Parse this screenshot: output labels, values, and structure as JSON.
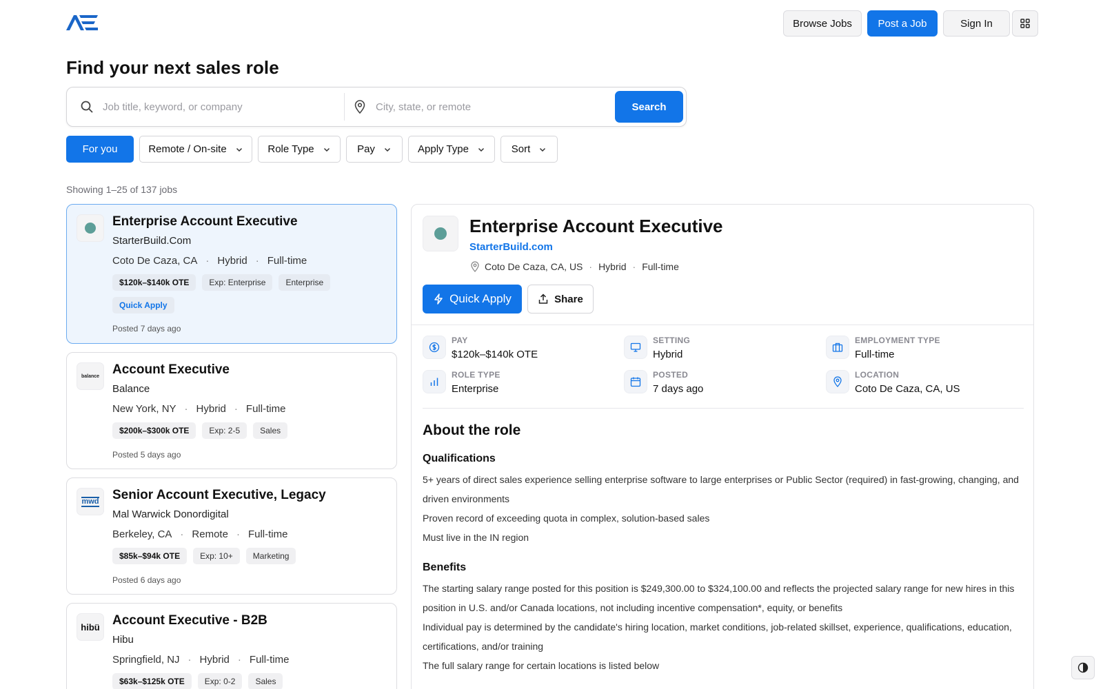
{
  "header": {
    "logo_alt": "AE",
    "browse_label": "Browse Jobs",
    "post_label": "Post a Job",
    "signin_label": "Sign In",
    "grid_icon": "grid-icon"
  },
  "page_title": "Find your next sales role",
  "search": {
    "keyword_placeholder": "Job title, keyword, or company",
    "keyword_value": "",
    "location_placeholder": "City, state, or remote",
    "location_value": "",
    "button_label": "Search"
  },
  "filters": [
    "For you",
    "Remote / On-site",
    "Role Type",
    "Pay",
    "Apply Type",
    "Sort"
  ],
  "results_count": "Showing 1–25 of 137 jobs",
  "jobs": [
    {
      "title": "Enterprise Account Executive",
      "company": "StarterBuild.Com",
      "location": "Coto De Caza, CA",
      "setting": "Hybrid",
      "employment": "Full-time",
      "pay": "$120k–$140k OTE",
      "experience": "Exp: Enterprise",
      "category": "Enterprise",
      "quick_apply": "Quick Apply",
      "posted": "Posted 7 days ago",
      "logo": "dot"
    },
    {
      "title": "Account Executive",
      "company": "Balance",
      "location": "New York, NY",
      "setting": "Hybrid",
      "employment": "Full-time",
      "pay": "$200k–$300k OTE",
      "experience": "Exp: 2-5",
      "category": "Sales",
      "posted": "Posted 5 days ago",
      "logo_text": "balance"
    },
    {
      "title": "Senior Account Executive, Legacy",
      "company": "Mal Warwick Donordigital",
      "location": "Berkeley, CA",
      "setting": "Remote",
      "employment": "Full-time",
      "pay": "$85k–$94k OTE",
      "experience": "Exp: 10+",
      "category": "Marketing",
      "posted": "Posted 6 days ago",
      "logo_text": "mwd"
    },
    {
      "title": "Account Executive - B2B",
      "company": "Hibu",
      "location": "Springfield, NJ",
      "setting": "Hybrid",
      "employment": "Full-time",
      "pay": "$63k–$125k OTE",
      "experience": "Exp: 0-2",
      "category": "Sales",
      "logo_text": "hibü"
    }
  ],
  "detail": {
    "title": "Enterprise Account Executive",
    "company": "StarterBuild.com",
    "location": "Coto De Caza, CA, US",
    "setting": "Hybrid",
    "employment": "Full-time",
    "quick_apply_label": "Quick Apply",
    "share_label": "Share",
    "stats": {
      "pay_label": "PAY",
      "pay_value": "$120k–$140k OTE",
      "setting_label": "SETTING",
      "setting_value": "Hybrid",
      "employment_label": "EMPLOYMENT TYPE",
      "employment_value": "Full-time",
      "role_label": "ROLE TYPE",
      "role_value": "Enterprise",
      "posted_label": "POSTED",
      "posted_value": "7 days ago",
      "location_label": "LOCATION",
      "location_value": "Coto De Caza, CA, US"
    },
    "about_heading": "About the role",
    "qualifications_heading": "Qualifications",
    "qualifications": [
      "5+ years of direct sales experience selling enterprise software to large enterprises or Public Sector (required) in fast-growing, changing, and driven environments",
      "Proven record of exceeding quota in complex, solution-based sales",
      "Must live in the IN region"
    ],
    "benefits_heading": "Benefits",
    "benefits": [
      "The starting salary range posted for this position is $249,300.00 to $324,100.00 and reflects the projected salary range for new hires in this position in U.S. and/or Canada locations, not including incentive compensation*, equity, or benefits",
      "Individual pay is determined by the candidate's hiring location, market conditions, job-related skillset, experience, qualifications, education, certifications, and/or training",
      "The full salary range for certain locations is listed below"
    ]
  },
  "colors": {
    "accent": "#1275e8",
    "active_card_bg": "#eef5fd",
    "logo_dot": "#5d9e98"
  },
  "theme_toggle_icon": "contrast-icon"
}
